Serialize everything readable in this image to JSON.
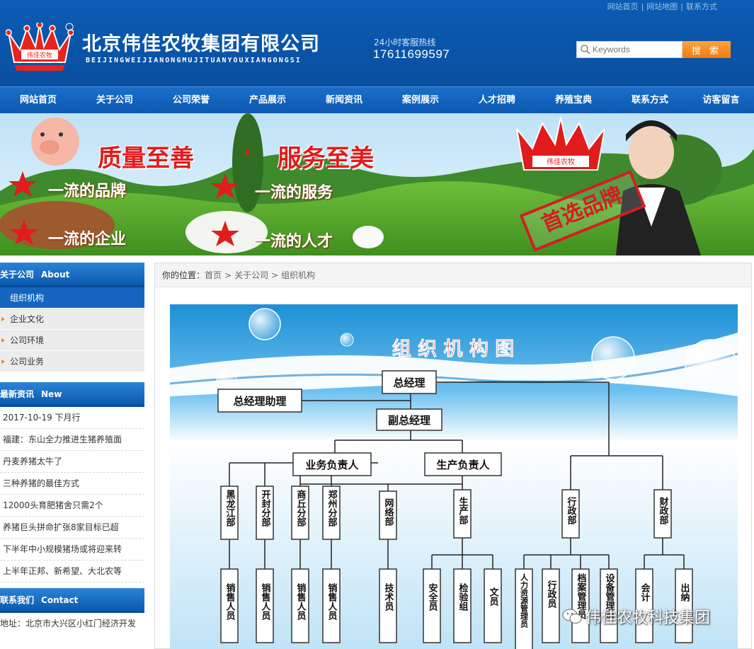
{
  "header": {
    "toplinks": [
      "网站首页",
      "网站地图",
      "联系方式"
    ],
    "brand_cn": "北京伟佳农牧集团有限公司",
    "brand_en": "BEIJINGWEIJIANONGMUJITUANYOUXIANGONGSI",
    "logo_text": "伟佳农牧",
    "hotline_label": "24小时客服热线",
    "hotline_number": "17611699597",
    "search_placeholder": "Keywords",
    "search_button": "搜 索"
  },
  "nav": [
    "网站首页",
    "关于公司",
    "公司荣誉",
    "产品展示",
    "新闻资讯",
    "案例展示",
    "人才招聘",
    "养殖宝典",
    "联系方式",
    "访客留言"
  ],
  "banner": {
    "slogan_left": "质量至善",
    "slogan_dot": "·",
    "slogan_right": "服务至美",
    "tags": [
      "一流的品牌",
      "一流的服务",
      "一流的企业",
      "一流的人才"
    ],
    "crown_text": "伟佳农牧",
    "stamp": "首选品牌"
  },
  "sidebar": {
    "about_title_cn": "关于公司",
    "about_title_en": "About",
    "about_active": "组织机构",
    "about_items": [
      "企业文化",
      "公司环境",
      "公司业务"
    ],
    "news_title_cn": "最新资讯",
    "news_title_en": "New",
    "news_items": [
      "2017-10-19 下月行",
      "福建：东山全力推进生猪养殖面",
      "丹麦养猪太牛了",
      "三种养猪的最佳方式",
      "12000头育肥猪舍只需2个",
      "养猪巨头拼命扩张8家目标已超",
      "下半年中小规模猪场或将迎来转",
      "上半年正邦、新希望、大北农等"
    ],
    "contact_title_cn": "联系我们",
    "contact_title_en": "Contact",
    "contact_address": "地址：北京市大兴区小红门经济开发"
  },
  "breadcrumb": {
    "label": "你的位置：",
    "items": [
      "首页",
      "关于公司",
      "组织机构"
    ]
  },
  "org_chart": {
    "title": "组 织 机 构 图",
    "general_manager": "总经理",
    "gm_assistant": "总经理助理",
    "deputy_gm": "副总经理",
    "business_head": "业务负责人",
    "production_head": "生产负责人",
    "admin_dept": "行政部",
    "finance_dept": "财政部",
    "business_branches": [
      "黑龙江部",
      "开封分部",
      "商丘分部",
      "郑州分部"
    ],
    "network_dept": "网络部",
    "production_dept": "生产部",
    "sales_staff": "销售人员",
    "tech_staff": "技术员",
    "production_staff": [
      "安全员",
      "检验组",
      "文员"
    ],
    "admin_staff": [
      "人力资源管理员",
      "行政员",
      "档案管理员",
      "设备管理员"
    ],
    "finance_staff": [
      "会计",
      "出纳"
    ]
  },
  "watermark": "伟佳农牧科技集团"
}
